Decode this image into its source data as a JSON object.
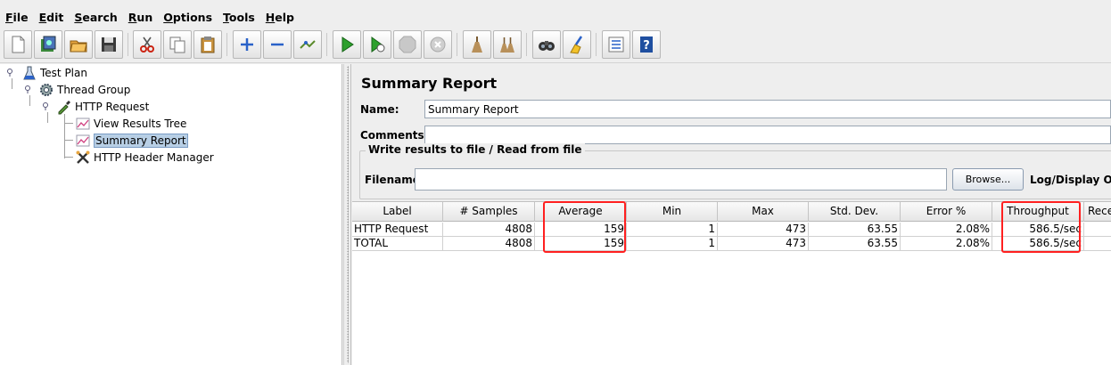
{
  "menu": [
    {
      "key": "file",
      "mnemonic": "F",
      "rest": "ile"
    },
    {
      "key": "edit",
      "mnemonic": "E",
      "rest": "dit"
    },
    {
      "key": "search",
      "mnemonic": "S",
      "rest": "earch"
    },
    {
      "key": "run",
      "mnemonic": "R",
      "rest": "un"
    },
    {
      "key": "options",
      "mnemonic": "O",
      "rest": "ptions"
    },
    {
      "key": "tools",
      "mnemonic": "T",
      "rest": "ools"
    },
    {
      "key": "help",
      "mnemonic": "H",
      "rest": "elp"
    }
  ],
  "toolbar_icons": [
    "new-icon",
    "templates-icon",
    "open-icon",
    "save-icon",
    "cut-icon",
    "copy-icon",
    "paste-icon",
    "expand-icon",
    "collapse-icon",
    "toggle-icon",
    "start-icon",
    "start-no-pause-icon",
    "stop-icon",
    "shutdown-icon",
    "clear-icon",
    "clear-all-icon",
    "search-icon",
    "reset-search-icon",
    "function-helper-icon",
    "help-icon"
  ],
  "tree": {
    "test_plan": "Test Plan",
    "thread_group": "Thread Group",
    "http_request": "HTTP Request",
    "view_results_tree": "View Results Tree",
    "summary_report": "Summary Report",
    "http_header_manager": "HTTP Header Manager"
  },
  "report": {
    "title": "Summary Report",
    "name_label": "Name:",
    "name_value": "Summary Report",
    "comments_label": "Comments:",
    "comments_value": "",
    "file_group_title": "Write results to file / Read from file",
    "filename_label": "Filename",
    "filename_value": "",
    "browse_label": "Browse...",
    "log_display_label": "Log/Display Only"
  },
  "table": {
    "columns": [
      "Label",
      "# Samples",
      "Average",
      "Min",
      "Max",
      "Std. Dev.",
      "Error %",
      "Throughput",
      "Rece"
    ],
    "rows": [
      [
        "HTTP Request",
        "4808",
        "159",
        "1",
        "473",
        "63.55",
        "2.08%",
        "586.5/sec",
        ""
      ],
      [
        "TOTAL",
        "4808",
        "159",
        "1",
        "473",
        "63.55",
        "2.08%",
        "586.5/sec",
        ""
      ]
    ]
  },
  "colors": {
    "highlight": "#ff2020",
    "selection": "#b8cfe5"
  }
}
